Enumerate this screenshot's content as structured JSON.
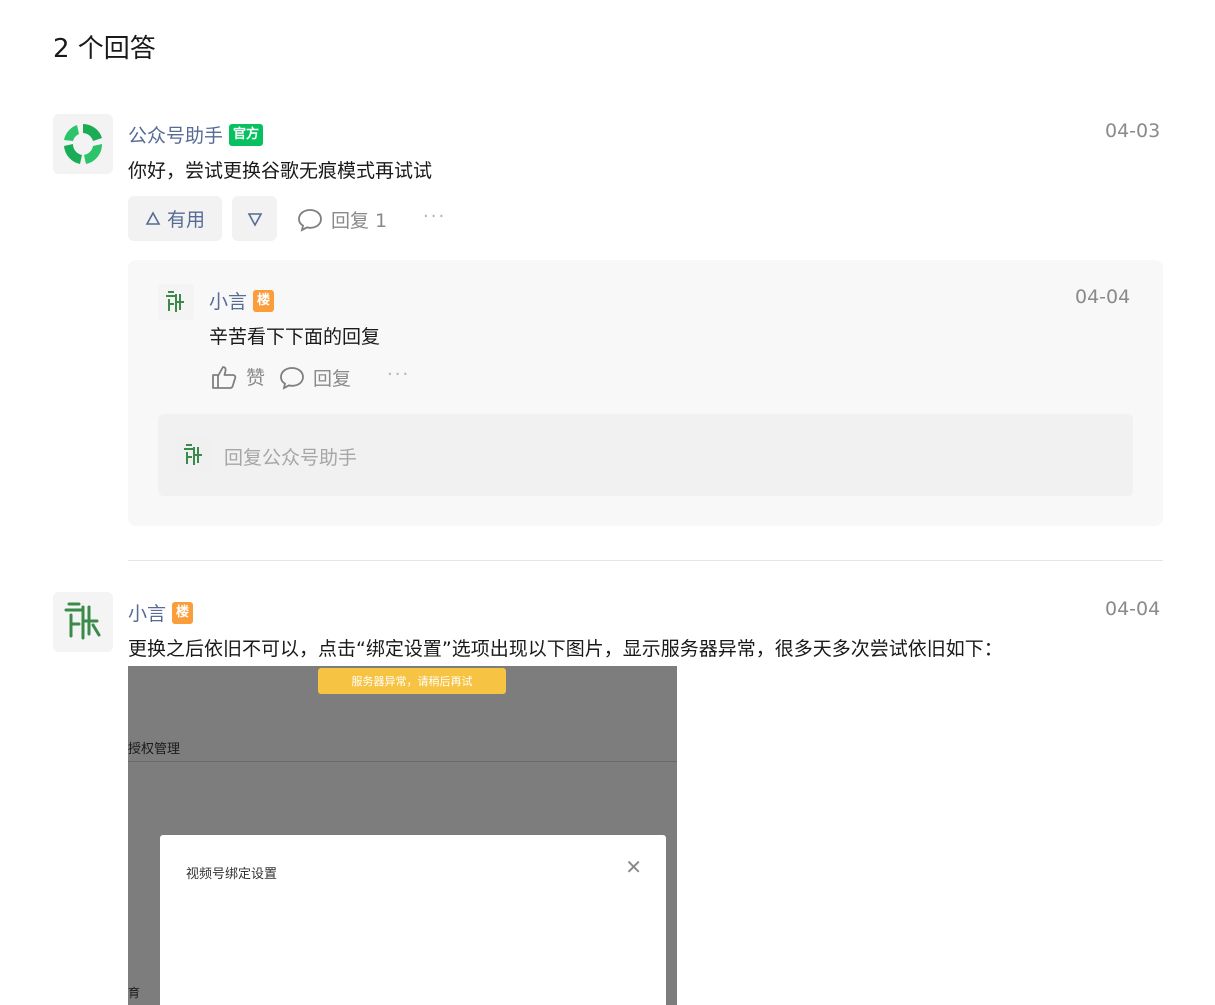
{
  "header": {
    "answer_count": "2 个回答"
  },
  "answer1": {
    "author": "公众号助手",
    "badge": "官方",
    "date": "04-03",
    "text": "你好，尝试更换谷歌无痕模式再试试",
    "useful_label": "有用",
    "reply_label": "回复 1",
    "more": "···"
  },
  "reply1": {
    "author": "小言",
    "badge": "楼",
    "date": "04-04",
    "text": "辛苦看下下面的回复",
    "like_label": "赞",
    "reply_label": "回复",
    "more": "···",
    "input_placeholder": "回复公众号助手"
  },
  "answer2": {
    "author": "小言",
    "badge": "楼",
    "date": "04-04",
    "text": "更换之后依旧不可以，点击“绑定设置”选项出现以下图片，显示服务器异常，很多天多次尝试依旧如下：",
    "screenshot": {
      "toast": "服务器异常，请稍后再试",
      "section_label": "授权管理",
      "dialog_title": "视频号绑定设置",
      "cut_text": "育"
    }
  },
  "colors": {
    "link": "#576b95",
    "official_badge": "#07c160",
    "floor_badge": "#fa9d3b",
    "toast": "#f7c343"
  }
}
